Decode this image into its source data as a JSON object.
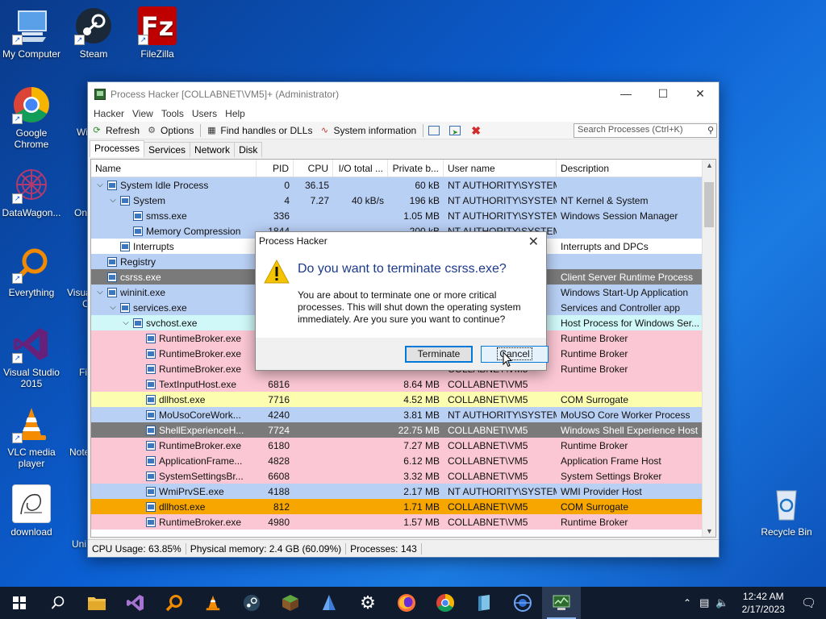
{
  "desktop": {
    "icons": [
      {
        "label": "My Computer"
      },
      {
        "label": "Steam"
      },
      {
        "label": "FileZilla"
      },
      {
        "label": "Google Chrome"
      },
      {
        "label": "DataWagon..."
      },
      {
        "label": "Everything"
      },
      {
        "label": "Visual Studio 2015"
      },
      {
        "label": "VLC media player"
      },
      {
        "label": "download"
      },
      {
        "label": "Recycle Bin"
      }
    ],
    "partial_labels": [
      "Wi",
      "On",
      "Visua",
      "C",
      "Fi",
      "Note",
      "Uni"
    ]
  },
  "window": {
    "title": "Process Hacker [COLLABNET\\VM5]+ (Administrator)",
    "menu": [
      "Hacker",
      "View",
      "Tools",
      "Users",
      "Help"
    ],
    "toolbar": {
      "refresh": "Refresh",
      "options": "Options",
      "find_handles": "Find handles or DLLs",
      "system_info": "System information"
    },
    "search_placeholder": "Search Processes (Ctrl+K)",
    "tabs": [
      "Processes",
      "Services",
      "Network",
      "Disk"
    ],
    "columns": [
      "Name",
      "PID",
      "CPU",
      "I/O total ...",
      "Private b...",
      "User name",
      "Description"
    ],
    "rows": [
      {
        "name": "System Idle Process",
        "pid": "0",
        "cpu": "36.15",
        "io": "",
        "priv": "60 kB",
        "user": "NT AUTHORITY\\SYSTEM",
        "desc": "",
        "color": "#b9d0f5",
        "indent": 0,
        "toggle": "v"
      },
      {
        "name": "System",
        "pid": "4",
        "cpu": "7.27",
        "io": "40 kB/s",
        "priv": "196 kB",
        "user": "NT AUTHORITY\\SYSTEM",
        "desc": "NT Kernel & System",
        "color": "#b9d0f5",
        "indent": 1,
        "toggle": "v"
      },
      {
        "name": "smss.exe",
        "pid": "336",
        "cpu": "",
        "io": "",
        "priv": "1.05 MB",
        "user": "NT AUTHORITY\\SYSTEM",
        "desc": "Windows Session Manager",
        "color": "#b9d0f5",
        "indent": 2,
        "toggle": ""
      },
      {
        "name": "Memory Compression",
        "pid": "1844",
        "cpu": "",
        "io": "",
        "priv": "200 kB",
        "user": "NT AUTHORITY\\SYSTEM",
        "desc": "",
        "color": "#b9d0f5",
        "indent": 2,
        "toggle": ""
      },
      {
        "name": "Interrupts",
        "pid": "",
        "cpu": "",
        "io": "",
        "priv": "",
        "user": "",
        "desc": "Interrupts and DPCs",
        "color": "#ffffff",
        "indent": 1,
        "toggle": ""
      },
      {
        "name": "Registry",
        "pid": "",
        "cpu": "",
        "io": "",
        "priv": "",
        "user": "M",
        "desc": "",
        "color": "#b9d0f5",
        "indent": 0,
        "toggle": ""
      },
      {
        "name": "csrss.exe",
        "pid": "",
        "cpu": "",
        "io": "",
        "priv": "",
        "user": "M",
        "desc": "Client Server Runtime Process",
        "color": "#7a7a7a",
        "indent": 0,
        "toggle": ""
      },
      {
        "name": "wininit.exe",
        "pid": "",
        "cpu": "",
        "io": "",
        "priv": "",
        "user": "M",
        "desc": "Windows Start-Up Application",
        "color": "#b9d0f5",
        "indent": 0,
        "toggle": "v"
      },
      {
        "name": "services.exe",
        "pid": "",
        "cpu": "",
        "io": "",
        "priv": "",
        "user": "M",
        "desc": "Services and Controller app",
        "color": "#b9d0f5",
        "indent": 1,
        "toggle": "v"
      },
      {
        "name": "svchost.exe",
        "pid": "",
        "cpu": "",
        "io": "",
        "priv": "",
        "user": "M",
        "desc": "Host Process for Windows Ser...",
        "color": "#d0f8f8",
        "indent": 2,
        "toggle": "v"
      },
      {
        "name": "RuntimeBroker.exe",
        "pid": "",
        "cpu": "",
        "io": "",
        "priv": "",
        "user": "",
        "desc": "Runtime Broker",
        "color": "#fbc7d4",
        "indent": 3,
        "toggle": ""
      },
      {
        "name": "RuntimeBroker.exe",
        "pid": "",
        "cpu": "",
        "io": "",
        "priv": "",
        "user": "",
        "desc": "Runtime Broker",
        "color": "#fbc7d4",
        "indent": 3,
        "toggle": ""
      },
      {
        "name": "RuntimeBroker.exe",
        "pid": "",
        "cpu": "",
        "io": "",
        "priv": "",
        "user": "COLLABNET\\VM5",
        "desc": "Runtime Broker",
        "color": "#fbc7d4",
        "indent": 3,
        "toggle": ""
      },
      {
        "name": "TextInputHost.exe",
        "pid": "6816",
        "cpu": "",
        "io": "",
        "priv": "8.64 MB",
        "user": "COLLABNET\\VM5",
        "desc": "",
        "color": "#fbc7d4",
        "indent": 3,
        "toggle": ""
      },
      {
        "name": "dllhost.exe",
        "pid": "7716",
        "cpu": "",
        "io": "",
        "priv": "4.52 MB",
        "user": "COLLABNET\\VM5",
        "desc": "COM Surrogate",
        "color": "#fdfdb0",
        "indent": 3,
        "toggle": ""
      },
      {
        "name": "MoUsoCoreWork...",
        "pid": "4240",
        "cpu": "",
        "io": "",
        "priv": "3.81 MB",
        "user": "NT AUTHORITY\\SYSTEM",
        "desc": "MoUSO Core Worker Process",
        "color": "#b9d0f5",
        "indent": 3,
        "toggle": ""
      },
      {
        "name": "ShellExperienceH...",
        "pid": "7724",
        "cpu": "",
        "io": "",
        "priv": "22.75 MB",
        "user": "COLLABNET\\VM5",
        "desc": "Windows Shell Experience Host",
        "color": "#7a7a7a",
        "indent": 3,
        "toggle": ""
      },
      {
        "name": "RuntimeBroker.exe",
        "pid": "6180",
        "cpu": "",
        "io": "",
        "priv": "7.27 MB",
        "user": "COLLABNET\\VM5",
        "desc": "Runtime Broker",
        "color": "#fbc7d4",
        "indent": 3,
        "toggle": ""
      },
      {
        "name": "ApplicationFrame...",
        "pid": "4828",
        "cpu": "",
        "io": "",
        "priv": "6.12 MB",
        "user": "COLLABNET\\VM5",
        "desc": "Application Frame Host",
        "color": "#fbc7d4",
        "indent": 3,
        "toggle": ""
      },
      {
        "name": "SystemSettingsBr...",
        "pid": "6608",
        "cpu": "",
        "io": "",
        "priv": "3.32 MB",
        "user": "COLLABNET\\VM5",
        "desc": "System Settings Broker",
        "color": "#fbc7d4",
        "indent": 3,
        "toggle": ""
      },
      {
        "name": "WmiPrvSE.exe",
        "pid": "4188",
        "cpu": "",
        "io": "",
        "priv": "2.17 MB",
        "user": "NT AUTHORITY\\SYSTEM",
        "desc": "WMI Provider Host",
        "color": "#b9d0f5",
        "indent": 3,
        "toggle": ""
      },
      {
        "name": "dllhost.exe",
        "pid": "812",
        "cpu": "",
        "io": "",
        "priv": "1.71 MB",
        "user": "COLLABNET\\VM5",
        "desc": "COM Surrogate",
        "color": "#f7a600",
        "indent": 3,
        "toggle": ""
      },
      {
        "name": "RuntimeBroker.exe",
        "pid": "4980",
        "cpu": "",
        "io": "",
        "priv": "1.57 MB",
        "user": "COLLABNET\\VM5",
        "desc": "Runtime Broker",
        "color": "#fbc7d4",
        "indent": 3,
        "toggle": ""
      }
    ],
    "status": {
      "cpu": "CPU Usage: 63.85%",
      "memory": "Physical memory: 2.4 GB (60.09%)",
      "processes": "Processes: 143"
    }
  },
  "dialog": {
    "title": "Process Hacker",
    "heading": "Do you want to terminate csrss.exe?",
    "body": "You are about to terminate one or more critical processes. This will shut down the operating system immediately. Are you sure you want to continue?",
    "terminate_label": "Terminate",
    "cancel_label": "Cancel"
  },
  "taskbar": {
    "time": "12:42 AM",
    "date": "2/17/2023"
  },
  "colors": {
    "accent": "#0078d7",
    "heading": "#1c3a8c",
    "taskbar": "#101b2e"
  }
}
